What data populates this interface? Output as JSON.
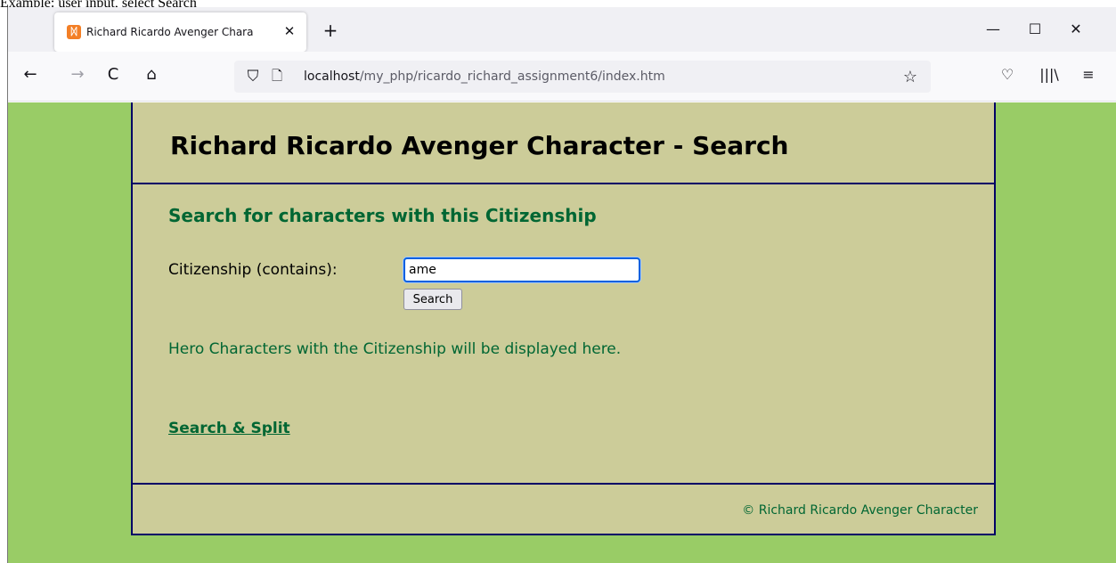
{
  "caption": "Example: user input, select Search",
  "browser": {
    "tab": {
      "title": "Richard Ricardo Avenger Chara",
      "favicon": "xampp-icon",
      "favicon_glyph": "ᛞ",
      "close_glyph": "✕"
    },
    "new_tab_glyph": "+",
    "window_controls": {
      "minimize": "—",
      "maximize": "☐",
      "close": "✕"
    },
    "nav": {
      "back": "←",
      "forward": "→",
      "reload": "C",
      "home": "⌂"
    },
    "url": {
      "host": "localhost",
      "path": "/my_php/ricardo_richard_assignment6/index.htm",
      "shield_glyph": "⛉",
      "page_glyph": "🗋",
      "star_glyph": "☆"
    },
    "toolbar": {
      "pocket": "♡",
      "library": "|||\\",
      "menu": "≡"
    }
  },
  "page": {
    "header_title": "Richard Ricardo Avenger Character - Search",
    "subtitle": "Search for characters with this Citizenship",
    "field_label": "Citizenship (contains):",
    "search_value": "ame",
    "search_button_label": "Search",
    "results_text": "Hero Characters with the Citizenship will be displayed here.",
    "split_link": "Search & Split",
    "footer": "© Richard Ricardo Avenger Character"
  },
  "colors": {
    "background": "#99cc66",
    "panel": "#cccc99",
    "border": "#000066",
    "accent_text": "#006633",
    "focus_ring": "#0060df"
  }
}
